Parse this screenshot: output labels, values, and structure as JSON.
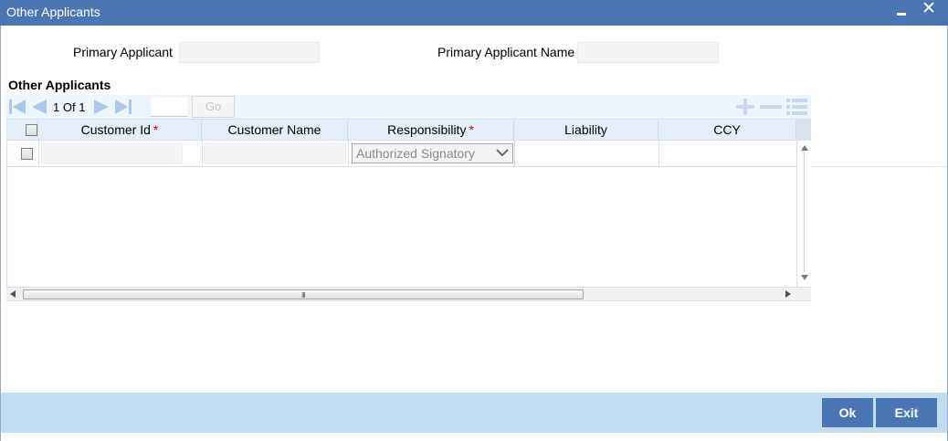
{
  "window": {
    "title": "Other Applicants",
    "minimize_icon": "minimize-icon",
    "close_icon": "close-icon"
  },
  "form": {
    "primary_applicant_label": "Primary Applicant",
    "primary_applicant_value": "",
    "primary_applicant_name_label": "Primary Applicant Name",
    "primary_applicant_name_value": ""
  },
  "section": {
    "title": "Other Applicants"
  },
  "pagination": {
    "current": "1",
    "of_label": "Of",
    "total": "1",
    "page_input": "",
    "go_label": "Go",
    "icons": [
      "first-page-icon",
      "previous-page-icon",
      "next-page-icon",
      "last-page-icon"
    ]
  },
  "toolbar_actions": [
    "add-row-icon",
    "delete-row-icon",
    "single-view-icon"
  ],
  "grid": {
    "columns": [
      {
        "label": "Customer Id",
        "required": true
      },
      {
        "label": "Customer Name",
        "required": false
      },
      {
        "label": "Responsibility",
        "required": true
      },
      {
        "label": "Liability",
        "required": false
      },
      {
        "label": "CCY",
        "required": false
      }
    ],
    "required_marker": "*",
    "rows": [
      {
        "customer_id": "",
        "customer_name": "",
        "responsibility": "Authorized Signatory",
        "liability": "",
        "ccy": ""
      }
    ],
    "scroll_grip": "III"
  },
  "footer": {
    "ok_label": "Ok",
    "exit_label": "Exit"
  },
  "colors": {
    "titlebar": "#4a77b4",
    "footer": "#c4dcf0",
    "button": "#4a77b4",
    "grid_header": "#e4eef9",
    "required": "#cc0000",
    "nav_icon": "#a9c9ea"
  }
}
